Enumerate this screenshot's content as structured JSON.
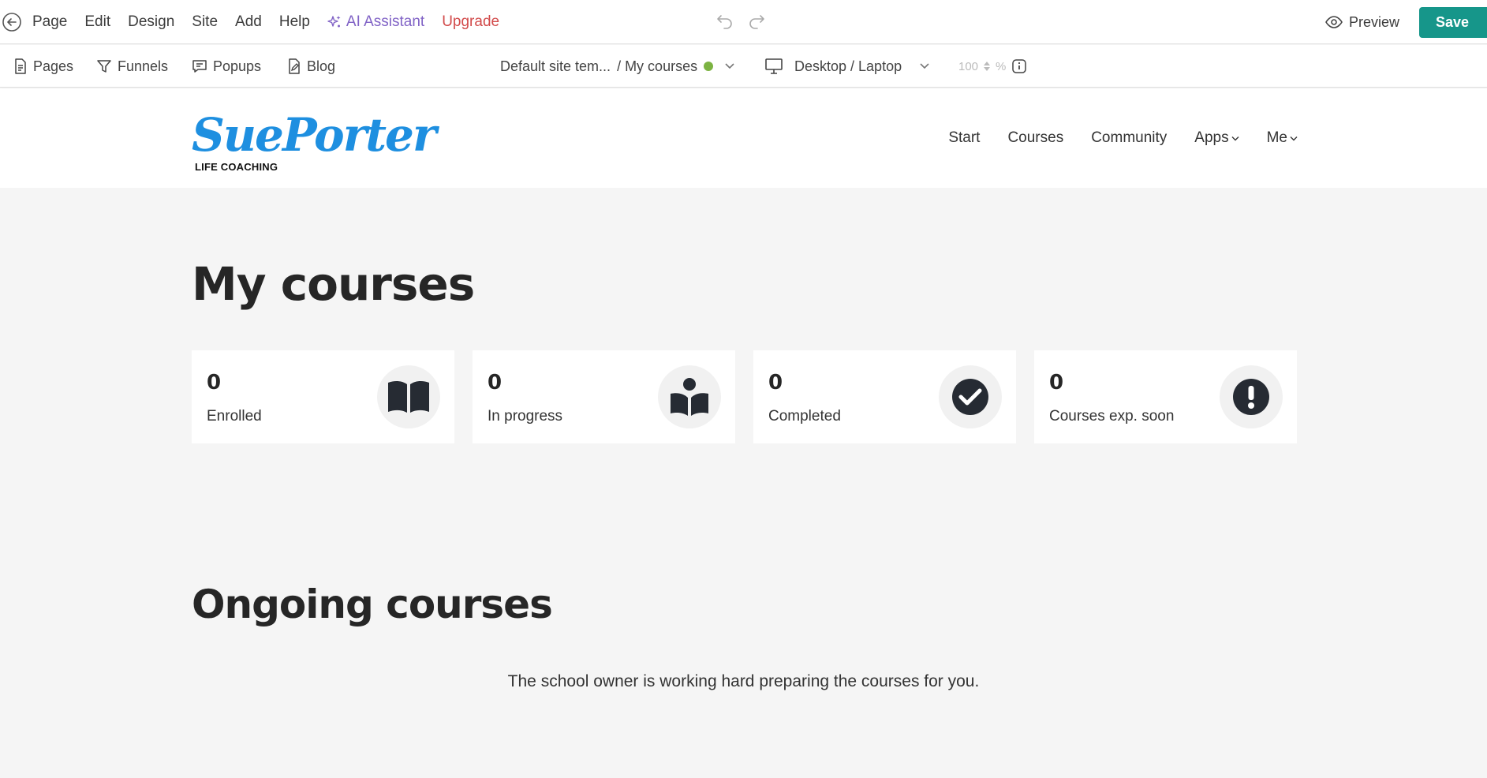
{
  "menu": {
    "items": [
      "Page",
      "Edit",
      "Design",
      "Site",
      "Add",
      "Help"
    ],
    "ai_assistant": "AI Assistant",
    "upgrade": "Upgrade",
    "preview": "Preview",
    "save": "Save"
  },
  "toolbar": {
    "pages": "Pages",
    "funnels": "Funnels",
    "popups": "Popups",
    "blog": "Blog",
    "template": "Default site tem...",
    "page_name": "/ My courses",
    "device": "Desktop / Laptop",
    "zoom_value": "100",
    "zoom_unit": "%"
  },
  "site": {
    "logo_name": "SuePorter",
    "logo_tagline": "LIFE COACHING",
    "nav": {
      "start": "Start",
      "courses": "Courses",
      "community": "Community",
      "apps": "Apps",
      "me": "Me"
    }
  },
  "content": {
    "title": "My courses",
    "stats": [
      {
        "value": "0",
        "label": "Enrolled",
        "icon": "open-book-icon"
      },
      {
        "value": "0",
        "label": "In progress",
        "icon": "reading-person-icon"
      },
      {
        "value": "0",
        "label": "Completed",
        "icon": "check-circle-icon"
      },
      {
        "value": "0",
        "label": "Courses exp. soon",
        "icon": "exclamation-circle-icon"
      }
    ],
    "ongoing_title": "Ongoing courses",
    "empty_message": "The school owner is working hard preparing the courses for you."
  },
  "colors": {
    "accent_save": "#16968a",
    "ai_purple": "#8163c6",
    "upgrade_red": "#d24b4b",
    "logo_blue": "#1e8fe0",
    "status_green": "#7cb342"
  }
}
